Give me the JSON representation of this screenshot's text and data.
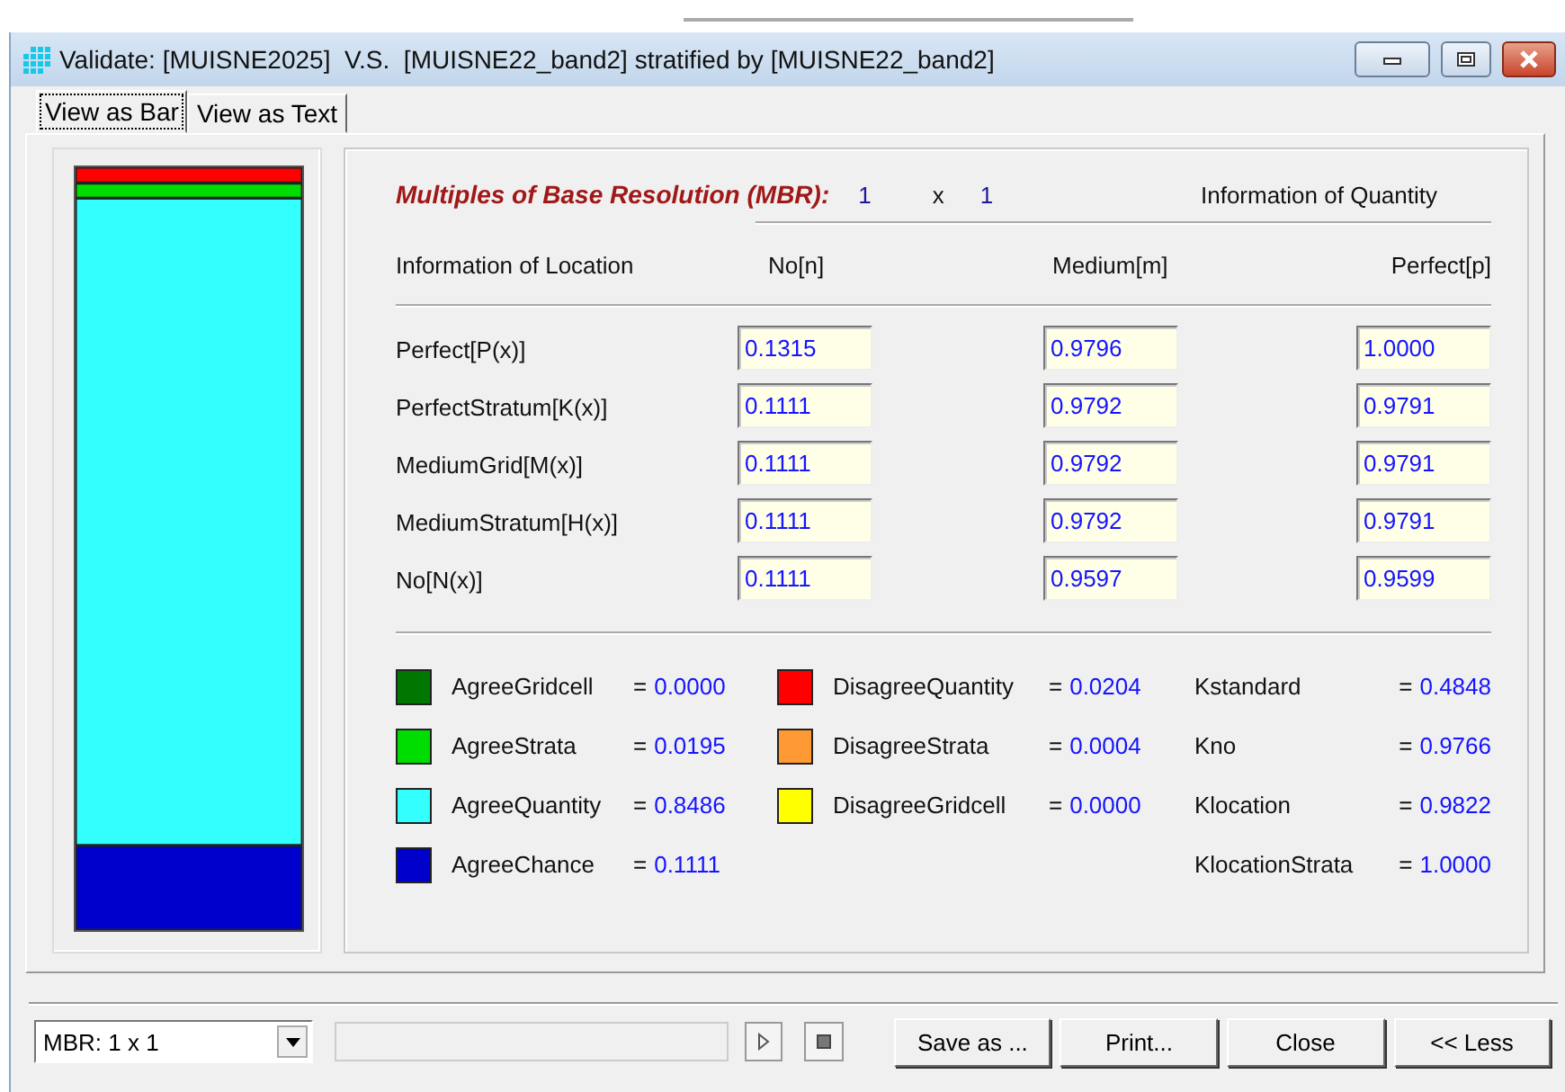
{
  "window": {
    "title": "Validate: [MUISNE2025]  V.S.  [MUISNE22_band2] stratified by [MUISNE22_band2]"
  },
  "tabs": [
    {
      "label": "View as Bar",
      "selected": true
    },
    {
      "label": "View as Text",
      "selected": false
    }
  ],
  "mbr": {
    "label": "Multiples of Base Resolution (MBR):",
    "rows": "1",
    "times": "x",
    "cols": "1"
  },
  "quantity_heading": "Information of Quantity",
  "table": {
    "columns": [
      "Information of Location",
      "No[n]",
      "Medium[m]",
      "Perfect[p]"
    ],
    "rows": [
      {
        "label": "Perfect[P(x)]",
        "values": [
          "0.1315",
          "0.9796",
          "1.0000"
        ]
      },
      {
        "label": "PerfectStratum[K(x)]",
        "values": [
          "0.1111",
          "0.9792",
          "0.9791"
        ]
      },
      {
        "label": "MediumGrid[M(x)]",
        "values": [
          "0.1111",
          "0.9792",
          "0.9791"
        ]
      },
      {
        "label": "MediumStratum[H(x)]",
        "values": [
          "0.1111",
          "0.9792",
          "0.9791"
        ]
      },
      {
        "label": "No[N(x)]",
        "values": [
          "0.1111",
          "0.9597",
          "0.9599"
        ]
      }
    ]
  },
  "legend": [
    {
      "label": "AgreeGridcell",
      "equals": "=",
      "value": "0.0000",
      "color": "#007700"
    },
    {
      "label": "AgreeStrata",
      "equals": "=",
      "value": "0.0195",
      "color": "#00dd00"
    },
    {
      "label": "AgreeQuantity",
      "equals": "=",
      "value": "0.8486",
      "color": "#33ffff"
    },
    {
      "label": "AgreeChance",
      "equals": "=",
      "value": "0.1111",
      "color": "#0000cc"
    },
    {
      "label": "DisagreeQuantity",
      "equals": "=",
      "value": "0.0204",
      "color": "#ff0000"
    },
    {
      "label": "DisagreeStrata",
      "equals": "=",
      "value": "0.0004",
      "color": "#ff9933"
    },
    {
      "label": "DisagreeGridcell",
      "equals": "=",
      "value": "0.0000",
      "color": "#ffff00"
    }
  ],
  "statistics": [
    {
      "label": "Kstandard",
      "equals": "=",
      "value": "0.4848"
    },
    {
      "label": "Kno",
      "equals": "=",
      "value": "0.9766"
    },
    {
      "label": "Klocation",
      "equals": "=",
      "value": "0.9822"
    },
    {
      "label": "KlocationStrata",
      "equals": "=",
      "value": "1.0000"
    }
  ],
  "footer": {
    "mbr_select": "MBR: 1 x 1",
    "buttons": [
      "Save as ...",
      "Print...",
      "Close",
      "<< Less"
    ]
  }
}
